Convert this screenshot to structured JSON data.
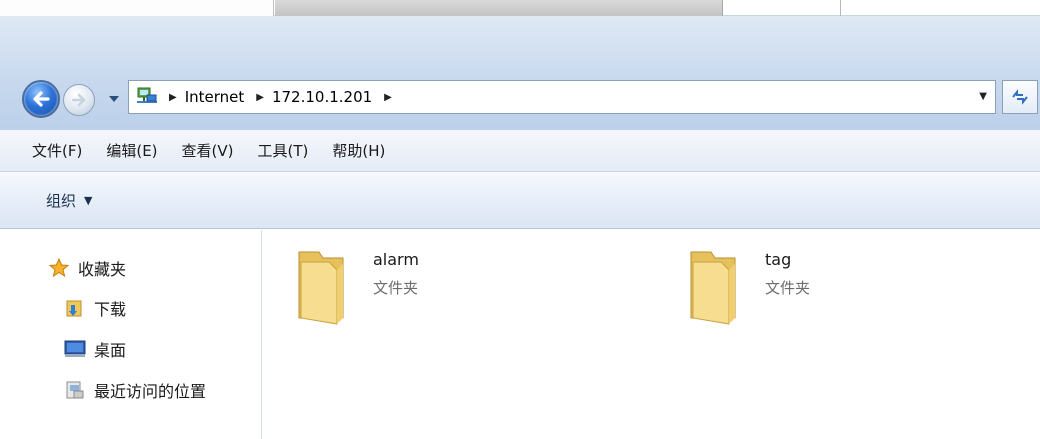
{
  "address_bar": {
    "crumbs": [
      "Internet",
      "172.10.1.201"
    ]
  },
  "menu": [
    "文件(F)",
    "编辑(E)",
    "查看(V)",
    "工具(T)",
    "帮助(H)"
  ],
  "command_bar": {
    "organize_label": "组织"
  },
  "nav_pane": {
    "favorites_label": "收藏夹",
    "items": [
      {
        "label": "下载",
        "icon": "downloads-folder-icon"
      },
      {
        "label": "桌面",
        "icon": "desktop-icon"
      },
      {
        "label": "最近访问的位置",
        "icon": "recent-places-icon"
      }
    ]
  },
  "files": [
    {
      "name": "alarm",
      "type": "文件夹"
    },
    {
      "name": "tag",
      "type": "文件夹"
    }
  ],
  "colors": {
    "chrome_top": "#dfe9f5",
    "chrome_bottom": "#bcd0ea",
    "folder_yellow": "#f3d57a",
    "back_button_blue": "#2c72d8"
  }
}
